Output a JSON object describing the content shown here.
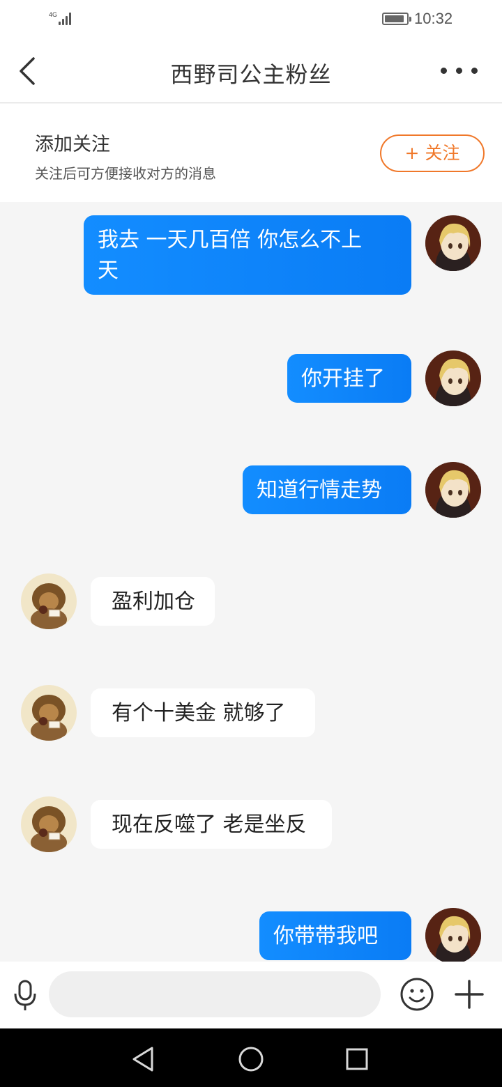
{
  "status_bar": {
    "network": "4G",
    "time": "10:32",
    "battery_level": 0.9
  },
  "header": {
    "title": "西野司公主粉丝"
  },
  "follow_bar": {
    "title": "添加关注",
    "subtitle": "关注后可方便接收对方的消息",
    "button_label": "+ 关注"
  },
  "messages": [
    {
      "sender": "me",
      "lines": [
        "我去 一天几百倍 你怎么不上",
        "天"
      ]
    },
    {
      "sender": "me",
      "text": "你开挂了"
    },
    {
      "sender": "me",
      "text": "知道行情走势"
    },
    {
      "sender": "other",
      "text": "盈利加仓"
    },
    {
      "sender": "other",
      "text": "有个十美金 就够了"
    },
    {
      "sender": "other",
      "text": "现在反噬了 老是坐反"
    },
    {
      "sender": "me",
      "text": "你带带我吧"
    }
  ],
  "input_bar": {
    "placeholder": ""
  },
  "colors": {
    "accent_orange": "#f0782a",
    "bubble_blue": "#138dff",
    "chat_background": "#f5f5f5"
  },
  "icons": {
    "back": "back-arrow-icon",
    "more": "more-dots-icon",
    "mic": "microphone-icon",
    "emoji": "emoji-smile-icon",
    "plus": "plus-icon",
    "sys_back": "triangle-back-icon",
    "sys_home": "circle-home-icon",
    "sys_recent": "square-recent-icon"
  }
}
